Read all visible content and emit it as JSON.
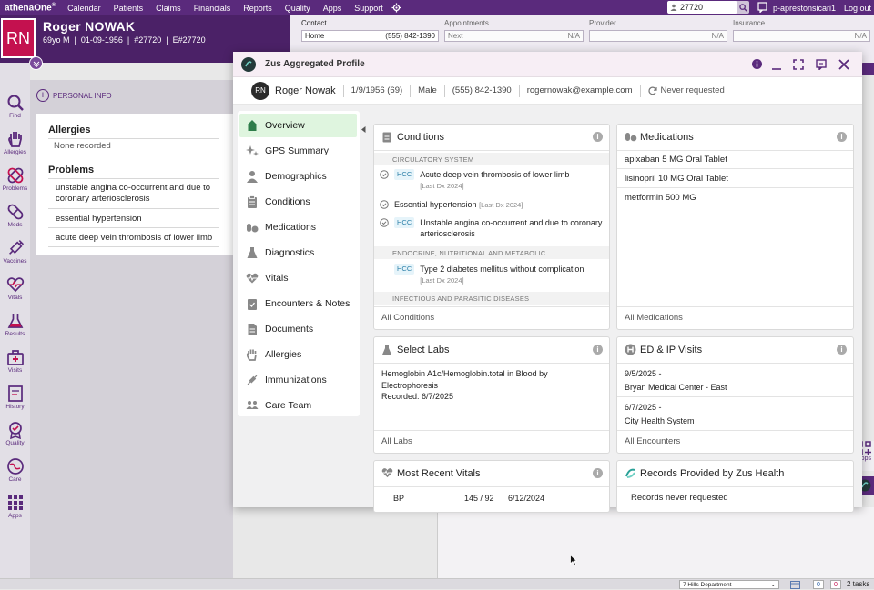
{
  "topnav": {
    "logo": "athenaOne",
    "logo_mark": "®",
    "links": [
      "Calendar",
      "Patients",
      "Claims",
      "Financials",
      "Reports",
      "Quality",
      "Apps",
      "Support"
    ],
    "search_value": "27720",
    "user": "p-aprestonsicari1",
    "logout": "Log out"
  },
  "patient": {
    "initials": "RN",
    "name": "Roger NOWAK",
    "age_sex": "69yo M",
    "dob": "01-09-1956",
    "id": "#27720",
    "enterprise_id": "E#27720"
  },
  "contact": {
    "label": "Contact",
    "type": "Home",
    "phone": "(555) 842-1390",
    "appointments_label": "Appointments",
    "next_label": "Next",
    "next_value": "N/A",
    "provider_label": "Provider",
    "provider_value": "N/A",
    "insurance_label": "Insurance",
    "insurance_value": "N/A"
  },
  "sidebar": [
    "Find",
    "Allergies",
    "Problems",
    "Meds",
    "Vaccines",
    "Vitals",
    "Results",
    "Visits",
    "History",
    "Quality",
    "Care",
    "Apps"
  ],
  "personal_info": "PERSONAL INFO",
  "summary": {
    "allergies_title": "Allergies",
    "allergies_value": "None recorded",
    "problems_title": "Problems",
    "problems": [
      "unstable angina co-occurrent and due to coronary arteriosclerosis",
      "essential hypertension",
      "acute deep vein thrombosis of lower limb"
    ]
  },
  "modal": {
    "title": "Zus Aggregated Profile",
    "patient": {
      "initials": "RN",
      "name": "Roger Nowak",
      "dob_age": "1/9/1956 (69)",
      "sex": "Male",
      "phone": "(555) 842-1390",
      "email": "rogernowak@example.com",
      "request_status": "Never requested"
    },
    "menu": [
      "Overview",
      "GPS Summary",
      "Demographics",
      "Conditions",
      "Medications",
      "Diagnostics",
      "Vitals",
      "Encounters & Notes",
      "Documents",
      "Allergies",
      "Immunizations",
      "Care Team"
    ],
    "conditions": {
      "title": "Conditions",
      "footer": "All Conditions",
      "cat1": "CIRCULATORY SYSTEM",
      "c1": {
        "badge": "HCC",
        "name": "Acute deep vein thrombosis of lower limb",
        "dx": "[Last Dx 2024]"
      },
      "c2": {
        "name": "Essential hypertension",
        "dx": "[Last Dx 2024]"
      },
      "c3": {
        "badge": "HCC",
        "name": "Unstable angina co-occurrent and due to coronary arteriosclerosis"
      },
      "cat2": "ENDOCRINE, NUTRITIONAL AND METABOLIC",
      "c4": {
        "badge": "HCC",
        "name": "Type 2 diabetes mellitus without complication",
        "dx": "[Last Dx 2024]"
      },
      "cat3": "INFECTIOUS AND PARASITIC DISEASES"
    },
    "medications": {
      "title": "Medications",
      "items": [
        "apixaban 5 MG Oral Tablet",
        "lisinopril 10 MG Oral Tablet",
        "metformin 500 MG"
      ],
      "footer": "All Medications"
    },
    "labs": {
      "title": "Select Labs",
      "name": "Hemoglobin A1c/Hemoglobin.total in Blood by Electrophoresis",
      "recorded": "Recorded: 6/7/2025",
      "footer": "All Labs"
    },
    "visits": {
      "title": "ED & IP Visits",
      "items": [
        {
          "date": "9/5/2025 -",
          "place": "Bryan Medical Center - East"
        },
        {
          "date": "6/7/2025 -",
          "place": "City Health System"
        }
      ],
      "footer": "All Encounters"
    },
    "vitals": {
      "title": "Most Recent Vitals",
      "row": {
        "name": "BP",
        "value": "145 / 92",
        "date": "6/12/2024"
      }
    },
    "records": {
      "title": "Records Provided by Zus Health",
      "status": "Records never requested"
    }
  },
  "status": {
    "department": "7 Hills Department",
    "badge1": "0",
    "badge2": "0",
    "tasks": "2 tasks"
  },
  "apps_right": "Apps",
  "colors": {
    "brand_purple": "#5a2a7c",
    "banner": "#4b2167",
    "avatar_red": "#c4114f",
    "active_menu": "#dff5df",
    "hcc_badge": "#2b7fa8"
  }
}
